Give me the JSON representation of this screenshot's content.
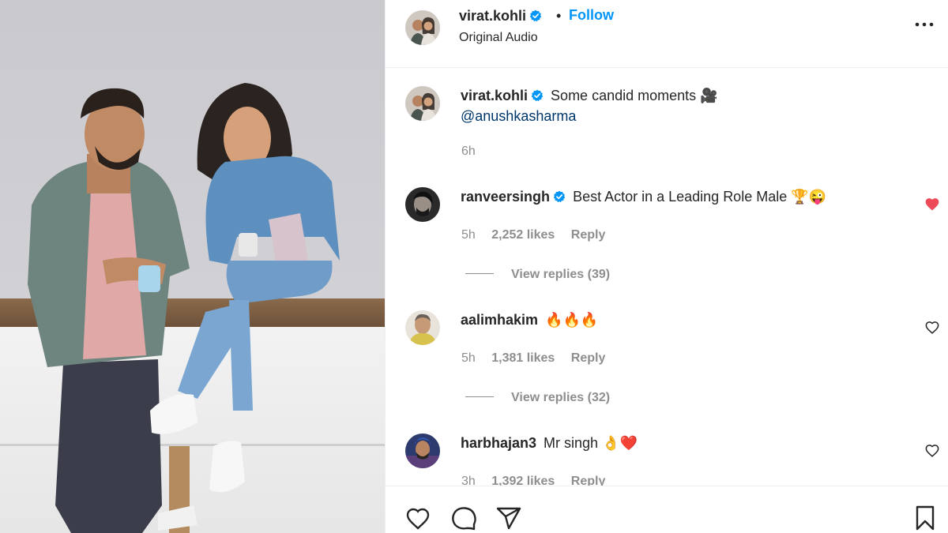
{
  "post": {
    "author": "virat.kohli",
    "follow_label": "Follow",
    "separator": "•",
    "audio": "Original Audio"
  },
  "caption": {
    "username": "virat.kohli",
    "text": "Some candid moments 🎥",
    "mention": "@anushkasharma",
    "time": "6h"
  },
  "comments": [
    {
      "username": "ranveersingh",
      "verified": true,
      "text": "Best Actor in a Leading Role Male 🏆😜",
      "time": "5h",
      "likes": "2,252 likes",
      "reply_label": "Reply",
      "view_replies": "View replies (39)",
      "liked": true
    },
    {
      "username": "aalimhakim",
      "verified": false,
      "text": "🔥🔥🔥",
      "time": "5h",
      "likes": "1,381 likes",
      "reply_label": "Reply",
      "view_replies": "View replies (32)",
      "liked": false
    },
    {
      "username": "harbhajan3",
      "verified": false,
      "text": "Mr singh 👌❤️",
      "time": "3h",
      "likes": "1,392 likes",
      "reply_label": "Reply",
      "liked": false
    }
  ],
  "icons": {
    "verified": "verified-badge-icon",
    "more": "more-options-icon",
    "like": "heart-icon",
    "comment": "comment-icon",
    "share": "share-icon",
    "save": "bookmark-icon"
  },
  "colors": {
    "accent": "#0095f6",
    "liked": "#ed4956",
    "muted": "#8e8e8e",
    "text": "#262626"
  }
}
